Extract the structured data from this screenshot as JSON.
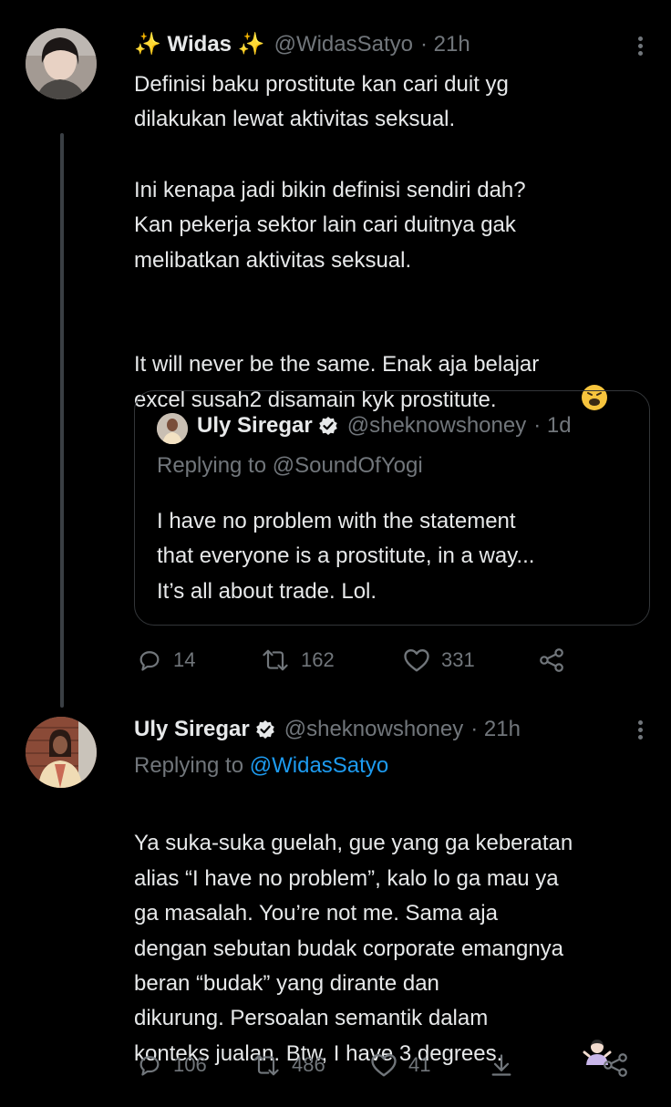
{
  "tweet1": {
    "name": "✨ Widas ✨",
    "handle": "@WidasSatyo",
    "time": "· 21h",
    "paragraph1": "Definisi baku prostitute kan cari duit yg\ndilakukan lewat aktivitas seksual.",
    "paragraph2": "Ini kenapa jadi bikin definisi sendiri dah?\nKan pekerja sektor lain cari duitnya gak\nmelibatkan aktivitas seksual.",
    "paragraph3": "It will never be the same. Enak aja belajar\nexcel susah2 disamain kyk prostitute.",
    "reply_count": "14",
    "retweet_count": "162",
    "like_count": "331"
  },
  "quote": {
    "name": "Uly Siregar",
    "handle": "@sheknowshoney",
    "time": "· 1d",
    "replying": "Replying to @SoundOfYogi",
    "text": "I have no problem with the statement\nthat everyone is a prostitute, in a way...\nIt’s all about trade. Lol."
  },
  "tweet2": {
    "name": "Uly Siregar",
    "handle": "@sheknowshoney",
    "time": "· 21h",
    "replying_prefix": "Replying to",
    "replying_user": "@WidasSatyo",
    "text": "Ya suka-suka guelah, gue yang ga keberatan\nalias “I have no problem”, kalo lo ga mau ya\nga masalah. You’re not me. Sama aja\ndengan sebutan budak corporate emangnya\nberan “budak” yang dirante dan\ndikurung. Persoalan semantik dalam\nkonteks jualan. Btw, I have 3 degrees.",
    "reply_count": "106",
    "retweet_count": "486",
    "like_count": "41"
  },
  "colors": {
    "background": "#000000",
    "text": "#e7e9ea",
    "muted": "#71767b",
    "link": "#1d9bf0",
    "verified": "#e7e9ea"
  },
  "icons": [
    "more-icon",
    "reply-icon",
    "retweet-icon",
    "like-icon",
    "share-icon",
    "download-icon",
    "verified-icon"
  ]
}
